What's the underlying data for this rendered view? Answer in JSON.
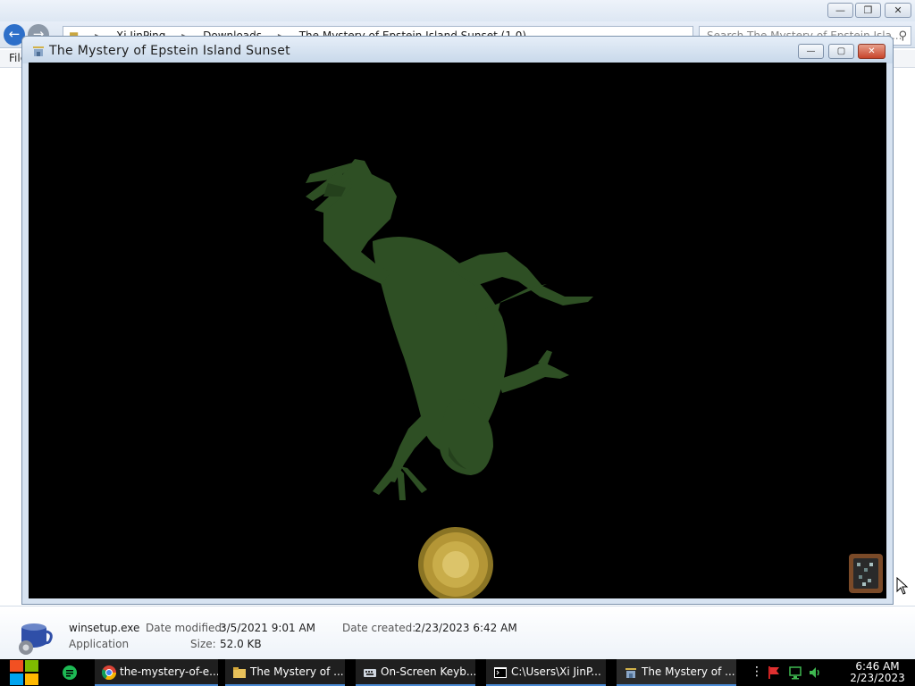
{
  "explorer": {
    "breadcrumb": [
      "Xi JinPing",
      "Downloads",
      "The Mystery of Epstein Island Sunset (1.0)"
    ],
    "search_placeholder": "Search The Mystery of Epstein Isla...",
    "menu_first": "File"
  },
  "details": {
    "file_name": "winsetup.exe",
    "file_type": "Application",
    "date_modified_label": "Date modified:",
    "date_modified_value": "3/5/2021 9:01 AM",
    "date_created_label": "Date created:",
    "date_created_value": "2/23/2023 6:42 AM",
    "size_label": "Size:",
    "size_value": "52.0 KB"
  },
  "game_window": {
    "title": "The Mystery of Epstein Island Sunset",
    "background_color": "#000000",
    "frog_color": "#2e4f24",
    "sun_color": "#c9ad4a"
  },
  "taskbar": {
    "items": [
      {
        "label": "the-mystery-of-e...",
        "icon": "chrome-icon"
      },
      {
        "label": "The Mystery of ...",
        "icon": "folder-icon"
      },
      {
        "label": "On-Screen Keyb...",
        "icon": "keyboard-icon"
      },
      {
        "label": "C:\\Users\\Xi JinP...",
        "icon": "console-icon"
      },
      {
        "label": "The Mystery of ...",
        "icon": "game-icon"
      }
    ],
    "clock_time": "6:46 AM",
    "clock_date": "2/23/2023"
  }
}
